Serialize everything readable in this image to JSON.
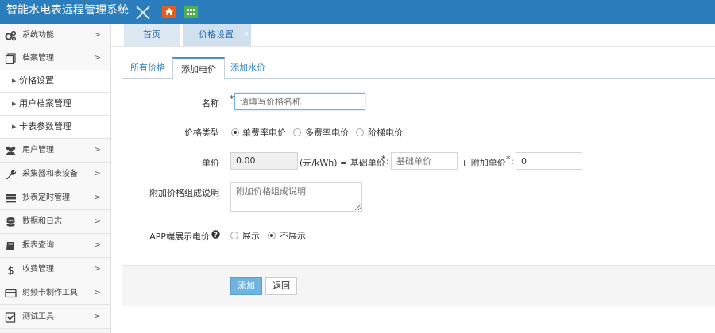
{
  "app": {
    "title": "智能水电表远程管理系统"
  },
  "sidebar": {
    "items": [
      {
        "label": "系统功能",
        "icon": "gears-icon"
      },
      {
        "label": "档案管理",
        "icon": "files-icon"
      },
      {
        "label": "用户管理",
        "icon": "users-icon"
      },
      {
        "label": "采集器和表设备",
        "icon": "wrench-icon"
      },
      {
        "label": "抄表定时管理",
        "icon": "list-icon"
      },
      {
        "label": "数据和日志",
        "icon": "database-icon"
      },
      {
        "label": "报表查询",
        "icon": "book-icon"
      },
      {
        "label": "收费管理",
        "icon": "dollar-icon"
      },
      {
        "label": "射频卡制作工具",
        "icon": "card-icon"
      },
      {
        "label": "测试工具",
        "icon": "checkbox-icon"
      }
    ],
    "sub_items": [
      "价格设置",
      "用户档案管理",
      "卡表参数管理"
    ],
    "chevron": ">"
  },
  "tabs": {
    "home": "首页",
    "price": "价格设置",
    "close": "×"
  },
  "subtabs": [
    "所有价格",
    "添加电价",
    "添加水价"
  ],
  "form": {
    "name_label": "名称",
    "name_placeholder": "请填写价格名称",
    "type_label": "价格类型",
    "type_options": [
      "单费率电价",
      "多费率电价",
      "阶梯电价"
    ],
    "selected_type": "单费率电价",
    "unit_label": "单价",
    "unit_value": "0.00",
    "unit_formula": "(元/kWh) = 基础单价",
    "base_placeholder": "基础单价",
    "extra_label": "+ 附加单价",
    "extra_value": "0",
    "desc_label": "附加价格组成说明",
    "desc_placeholder": "附加价格组成说明",
    "app_label": "APP端展示电价",
    "app_options": [
      "展示",
      "不展示"
    ],
    "app_selected": "不展示",
    "required_mark": "*",
    "colon": ":"
  },
  "buttons": {
    "add": "添加",
    "back": "返回"
  },
  "colors": {
    "topbar": "#2b7dbc",
    "accent": "#6fb3e0",
    "home_button": "#e25d1e",
    "grid_button": "#4caf50",
    "required": "#d15b47"
  }
}
